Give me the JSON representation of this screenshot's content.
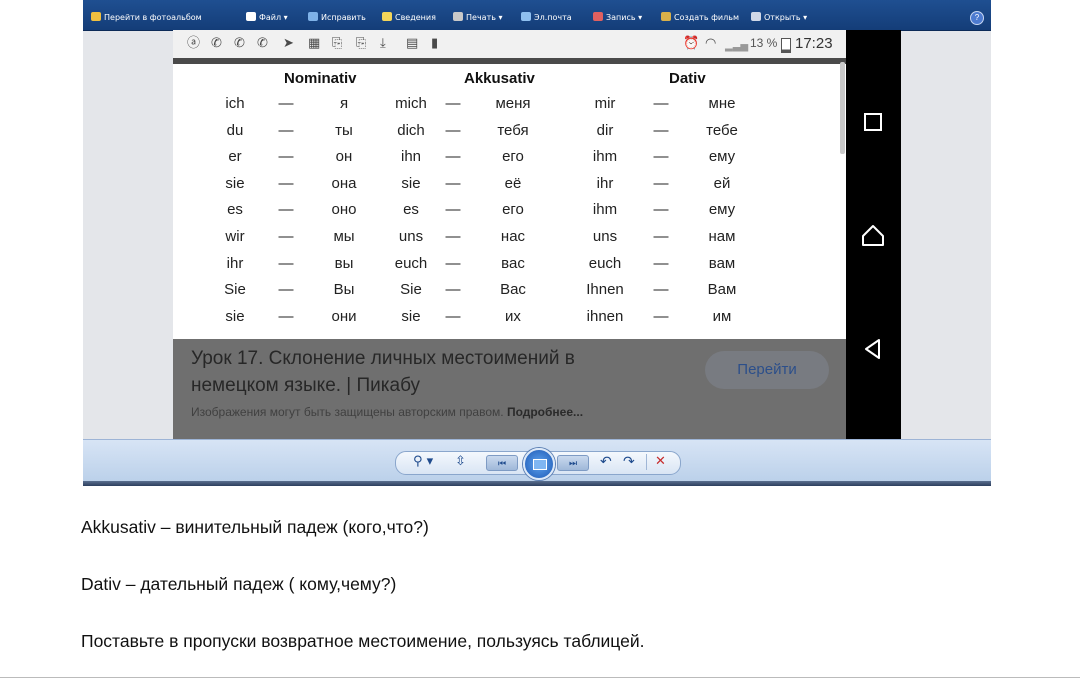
{
  "viewer": {
    "menu": {
      "items": [
        {
          "label": "Перейти в фотоальбом",
          "color": "#f0c040"
        },
        {
          "label": "Файл ▾",
          "color": "#ffffff"
        },
        {
          "label": "Исправить",
          "color": "#7fb2e8"
        },
        {
          "label": "Сведения",
          "color": "#f3d55a"
        },
        {
          "label": "Печать ▾",
          "color": "#c9c9c9"
        },
        {
          "label": "Эл.почта",
          "color": "#8fc0f0"
        },
        {
          "label": "Запись ▾",
          "color": "#e06060"
        },
        {
          "label": "Создать фильм",
          "color": "#d8b04a"
        },
        {
          "label": "Открыть ▾",
          "color": "#d0d8e8"
        }
      ],
      "help": "?"
    },
    "toolbar": {
      "zoom": "⚲ ▾",
      "fit": "⇳",
      "prev": "⏮",
      "next": "⏭",
      "rotate_ccw": "↶",
      "rotate_cw": "↷",
      "delete": "✕"
    }
  },
  "phone": {
    "status": {
      "icons": [
        "ⓐ",
        "✆",
        "✆",
        "✆",
        "➤",
        "▦",
        "⎘",
        "⎘",
        "⤓",
        "▤",
        "▮"
      ],
      "alarm": "⏰",
      "wifi": "◠",
      "signal": "▂▃▅",
      "battery_pct": "13 %",
      "clock": "17:23"
    },
    "table": {
      "headers": [
        "Nominativ",
        "Akkusativ",
        "Dativ"
      ],
      "dash": "—",
      "rows": [
        [
          "ich",
          "я",
          "mich",
          "меня",
          "mir",
          "мне"
        ],
        [
          "du",
          "ты",
          "dich",
          "тебя",
          "dir",
          "тебе"
        ],
        [
          "er",
          "он",
          "ihn",
          "его",
          "ihm",
          "ему"
        ],
        [
          "sie",
          "она",
          "sie",
          "её",
          "ihr",
          "ей"
        ],
        [
          "es",
          "оно",
          "es",
          "его",
          "ihm",
          "ему"
        ],
        [
          "wir",
          "мы",
          "uns",
          "нас",
          "uns",
          "нам"
        ],
        [
          "ihr",
          "вы",
          "euch",
          "вас",
          "euch",
          "вам"
        ],
        [
          "Sie",
          "Вы",
          "Sie",
          "Вас",
          "Ihnen",
          "Вам"
        ],
        [
          "sie",
          "они",
          "sie",
          "их",
          "ihnen",
          "им"
        ]
      ]
    },
    "result": {
      "title": "Урок 17. Склонение личных местоимений в немецком языке. | Пикабу",
      "button": "Перейти",
      "copyright": "Изображения могут быть защищены авторским правом.",
      "more": "Подробнее..."
    },
    "nav": [
      "square-icon",
      "home-icon",
      "back-icon"
    ]
  },
  "document": {
    "line1": "Akkusativ – винительный падеж (кого,что?)",
    "line2": "Dativ – дательный падеж ( кому,чему?)",
    "line3": "Поставьте в пропуски возвратное местоимение, пользуясь таблицей."
  }
}
